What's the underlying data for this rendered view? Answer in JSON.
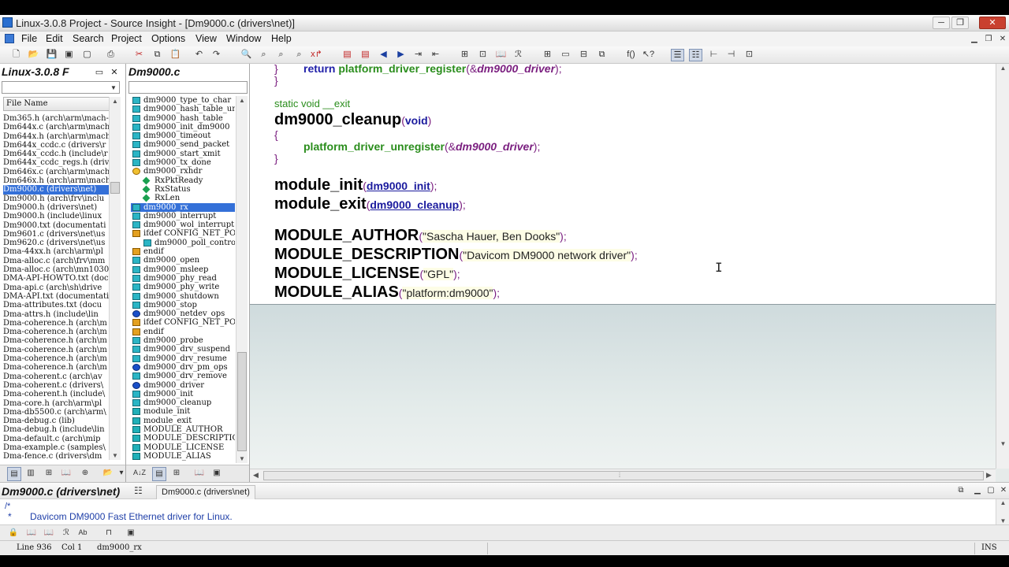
{
  "window": {
    "title": "Linux-3.0.8 Project - Source Insight - [Dm9000.c (drivers\\net)]",
    "minimize": "─",
    "restore": "❐",
    "close": "✕"
  },
  "menu": {
    "items": [
      "File",
      "Edit",
      "Search",
      "Project",
      "Options",
      "View",
      "Window",
      "Help"
    ]
  },
  "project_window": {
    "title": "Linux-3.0.8 F",
    "column_header": "File Name",
    "files": [
      "Dm365.h (arch\\arm\\mach-",
      "Dm644x.c (arch\\arm\\mach",
      "Dm644x.h (arch\\arm\\mach",
      "Dm644x_ccdc.c (drivers\\r",
      "Dm644x_ccdc.h (include\\r",
      "Dm644x_ccdc_regs.h (driv",
      "Dm646x.c (arch\\arm\\mach",
      "Dm646x.h (arch\\arm\\mach",
      "Dm9000.c (drivers\\net)",
      "Dm9000.h (arch\\frv\\inclu",
      "Dm9000.h (drivers\\net)",
      "Dm9000.h (include\\linux",
      "Dm9000.txt (documentati",
      "Dm9601.c (drivers\\net\\us",
      "Dm9620.c (drivers\\net\\us",
      "Dma-44xx.h (arch\\arm\\pl",
      "Dma-alloc.c (arch\\frv\\mm",
      "Dma-alloc.c (arch\\mn1030",
      "DMA-API-HOWTO.txt (docu",
      "Dma-api.c (arch\\sh\\drive",
      "DMA-API.txt (documentati",
      "Dma-attributes.txt (docu",
      "Dma-attrs.h (include\\lin",
      "Dma-coherence.h (arch\\m",
      "Dma-coherence.h (arch\\m",
      "Dma-coherence.h (arch\\m",
      "Dma-coherence.h (arch\\m",
      "Dma-coherence.h (arch\\m",
      "Dma-coherence.h (arch\\m",
      "Dma-coherent.c (arch\\av",
      "Dma-coherent.c (drivers\\",
      "Dma-coherent.h (include\\",
      "Dma-core.h (arch\\arm\\pl",
      "Dma-db5500.c (arch\\arm\\",
      "Dma-debug.c (lib)",
      "Dma-debug.h (include\\lin",
      "Dma-default.c (arch\\mip",
      "Dma-example.c (samples\\",
      "Dma-fence.c (drivers\\dm"
    ],
    "selected_index": 8
  },
  "symbol_window": {
    "title": "Dm9000.c",
    "symbols": [
      {
        "label": "dm9000_type_to_char",
        "icon": "func",
        "child": false
      },
      {
        "label": "dm9000_hash_table_unl",
        "icon": "func",
        "child": false
      },
      {
        "label": "dm9000_hash_table",
        "icon": "func",
        "child": false
      },
      {
        "label": "dm9000_init_dm9000",
        "icon": "func",
        "child": false
      },
      {
        "label": "dm9000_timeout",
        "icon": "func",
        "child": false
      },
      {
        "label": "dm9000_send_packet",
        "icon": "func",
        "child": false
      },
      {
        "label": "dm9000_start_xmit",
        "icon": "func",
        "child": false
      },
      {
        "label": "dm9000_tx_done",
        "icon": "func",
        "child": false
      },
      {
        "label": "dm9000_rxhdr",
        "icon": "struct",
        "child": false
      },
      {
        "label": "RxPktReady",
        "icon": "member",
        "child": true
      },
      {
        "label": "RxStatus",
        "icon": "member",
        "child": true
      },
      {
        "label": "RxLen",
        "icon": "member",
        "child": true
      },
      {
        "label": "dm9000_rx",
        "icon": "func",
        "child": false
      },
      {
        "label": "dm9000_interrupt",
        "icon": "func",
        "child": false
      },
      {
        "label": "dm9000_wol_interrupt",
        "icon": "func",
        "child": false
      },
      {
        "label": "ifdef CONFIG_NET_POLL",
        "icon": "cond",
        "child": false
      },
      {
        "label": "dm9000_poll_contro",
        "icon": "func",
        "child": true
      },
      {
        "label": "endif",
        "icon": "cond",
        "child": false
      },
      {
        "label": "dm9000_open",
        "icon": "func",
        "child": false
      },
      {
        "label": "dm9000_msleep",
        "icon": "func",
        "child": false
      },
      {
        "label": "dm9000_phy_read",
        "icon": "func",
        "child": false
      },
      {
        "label": "dm9000_phy_write",
        "icon": "func",
        "child": false
      },
      {
        "label": "dm9000_shutdown",
        "icon": "func",
        "child": false
      },
      {
        "label": "dm9000_stop",
        "icon": "func",
        "child": false
      },
      {
        "label": "dm9000_netdev_ops",
        "icon": "var",
        "child": false
      },
      {
        "label": "ifdef CONFIG_NET_POLL",
        "icon": "cond",
        "child": false
      },
      {
        "label": "endif",
        "icon": "cond",
        "child": false
      },
      {
        "label": "dm9000_probe",
        "icon": "func",
        "child": false
      },
      {
        "label": "dm9000_drv_suspend",
        "icon": "func",
        "child": false
      },
      {
        "label": "dm9000_drv_resume",
        "icon": "func",
        "child": false
      },
      {
        "label": "dm9000_drv_pm_ops",
        "icon": "var",
        "child": false
      },
      {
        "label": "dm9000_drv_remove",
        "icon": "func",
        "child": false
      },
      {
        "label": "dm9000_driver",
        "icon": "var",
        "child": false
      },
      {
        "label": "dm9000_init",
        "icon": "func",
        "child": false
      },
      {
        "label": "dm9000_cleanup",
        "icon": "func",
        "child": false
      },
      {
        "label": "module_init",
        "icon": "macro",
        "child": false
      },
      {
        "label": "module_exit",
        "icon": "macro",
        "child": false
      },
      {
        "label": "MODULE_AUTHOR",
        "icon": "macro",
        "child": false
      },
      {
        "label": "MODULE_DESCRIPTION",
        "icon": "macro",
        "child": false
      },
      {
        "label": "MODULE_LICENSE",
        "icon": "macro",
        "child": false
      },
      {
        "label": "MODULE_ALIAS",
        "icon": "macro",
        "child": false
      }
    ],
    "selected_index": 12
  },
  "code": {
    "line1_kw": "return",
    "line1_fn": "platform_driver_register",
    "line1_open": "(&",
    "line1_id": "dm9000_driver",
    "line1_close": ");",
    "brace_close": "}",
    "brace_open": "{",
    "line3_text": "static void __exit",
    "line4_name": "dm9000_cleanup",
    "line4_open": "(",
    "line4_param": "void",
    "line4_close": ")",
    "line6_fn": "platform_driver_unregister",
    "line6_open": "(&",
    "line6_id": "dm9000_driver",
    "line6_close": ");",
    "init_name": "module_init",
    "init_open": "(",
    "init_param": "dm9000_init",
    "init_close": ");",
    "exit_name": "module_exit",
    "exit_open": "(",
    "exit_param": "dm9000_cleanup",
    "exit_close": ");",
    "author_name": "MODULE_AUTHOR",
    "author_open": "(",
    "author_str": "\"Sascha Hauer, Ben Dooks\"",
    "author_close": ");",
    "desc_name": "MODULE_DESCRIPTION",
    "desc_open": "(",
    "desc_str": "\"Davicom DM9000 network driver\"",
    "desc_close": ");",
    "lic_name": "MODULE_LICENSE",
    "lic_open": "(",
    "lic_str": "\"GPL\"",
    "lic_close": ");",
    "alias_name": "MODULE_ALIAS",
    "alias_open": "(",
    "alias_str": "\"platform:dm9000\"",
    "alias_close": ");"
  },
  "context_window": {
    "title": "Dm9000.c (drivers\\net)",
    "tab": "Dm9000.c (drivers\\net)",
    "line1": "/*",
    "line2_star": "*",
    "line2_text": "Davicom DM9000 Fast Ethernet driver for Linux."
  },
  "status": {
    "line": "Line 936",
    "col": "Col 1",
    "symbol": "dm9000_rx",
    "mode": "INS"
  }
}
